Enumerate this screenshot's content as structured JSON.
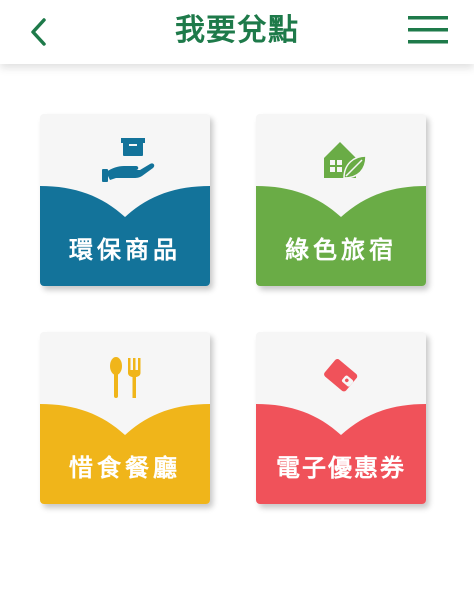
{
  "header": {
    "title": "我要兌點",
    "back_icon": "chevron-left-icon",
    "menu_icon": "hamburger-menu-icon",
    "accent_color": "#1e7a4a"
  },
  "cards": [
    {
      "label": "環保商品",
      "icon": "hand-holding-box-icon",
      "color": "#13739a"
    },
    {
      "label": "綠色旅宿",
      "icon": "green-house-leaf-icon",
      "color": "#6aac46"
    },
    {
      "label": "惜食餐廳",
      "icon": "spoon-fork-icon",
      "color": "#f0b51a"
    },
    {
      "label": "電子優惠券",
      "icon": "e-coupon-wallet-icon",
      "color": "#f0525a"
    }
  ]
}
